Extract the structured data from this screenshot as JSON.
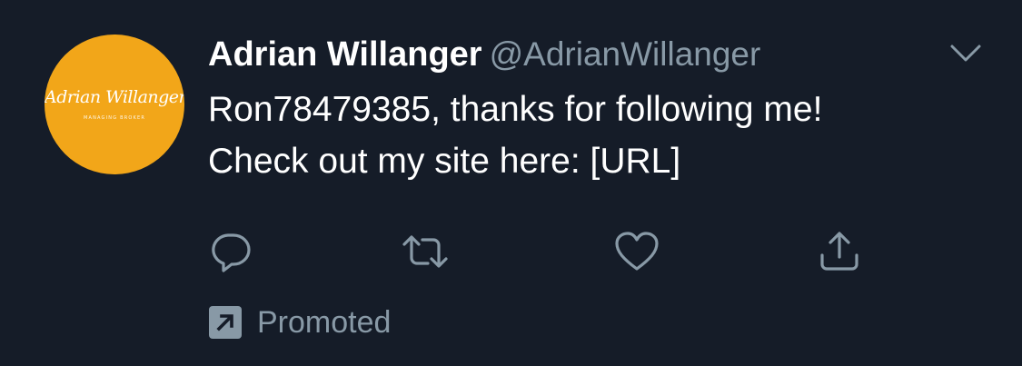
{
  "tweet": {
    "avatar": {
      "logo_text": "Adrian Willanger",
      "logo_subtext": "MANAGING BROKER",
      "background_color": "#f2a619"
    },
    "display_name": "Adrian Willanger",
    "handle": "@AdrianWillanger",
    "body": "Ron78479385, thanks for following me!\nCheck out my site here: [URL]",
    "menu_icon": "chevron-down-icon",
    "actions": [
      {
        "name": "reply",
        "icon": "reply-icon"
      },
      {
        "name": "retweet",
        "icon": "retweet-icon"
      },
      {
        "name": "like",
        "icon": "heart-icon"
      },
      {
        "name": "share",
        "icon": "share-icon"
      }
    ],
    "promoted_label": "Promoted",
    "colors": {
      "background": "#151c28",
      "text_primary": "#ffffff",
      "text_secondary": "#8899a6"
    }
  }
}
